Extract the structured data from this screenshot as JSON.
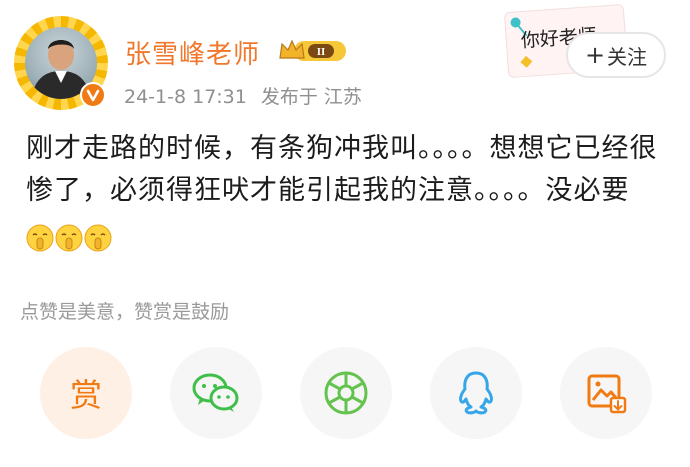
{
  "post": {
    "author": "张雪峰老师",
    "level_badge": "II",
    "date": "24-1-8 17:31",
    "location": "发布于 江苏",
    "follow_label": "关注",
    "follow_plus": "+",
    "text_main": "刚才走路的时候，有条狗冲我叫。。。。想想它已经很惨了，必须得狂吠才能引起我的注意。。。。没必要",
    "emojis": [
      "shush-emoji",
      "shush-emoji",
      "shush-emoji"
    ]
  },
  "sticker": {
    "text": "你好老师"
  },
  "reward": {
    "hint": "点赞是美意，赞赏是鼓励",
    "reward_label": "赏"
  },
  "share": {
    "items": [
      "reward",
      "wechat-icon",
      "moments-icon",
      "qq-icon",
      "save-image-icon"
    ]
  },
  "colors": {
    "accent_orange": "#f0782c",
    "wechat_green": "#3fbf49",
    "moments_green": "#63c34d",
    "qq_blue": "#35a6e8",
    "save_orange": "#f07a13"
  }
}
